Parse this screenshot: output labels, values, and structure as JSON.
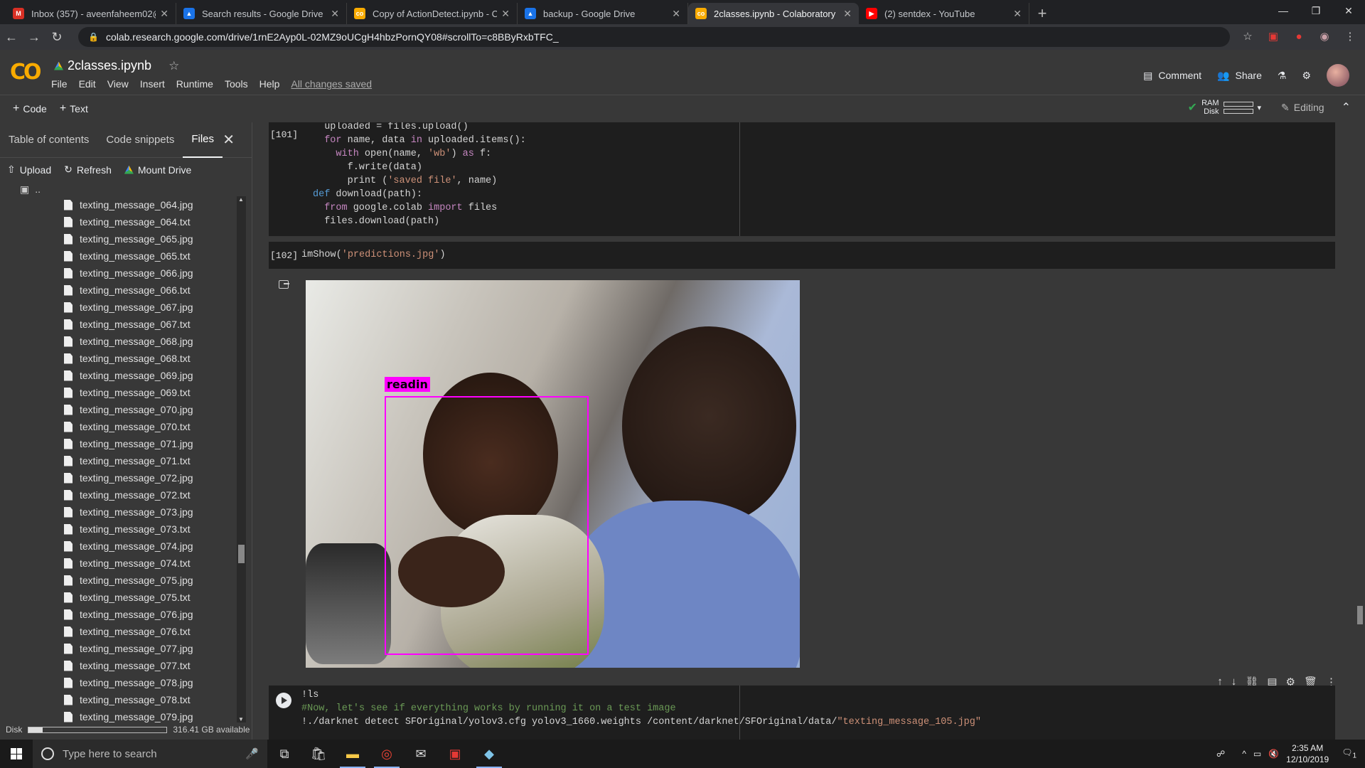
{
  "browser": {
    "tabs": [
      {
        "title": "Inbox (357) - aveenfaheem02@g",
        "icon": "gmail-icon",
        "color": "#d93025",
        "glyph": "M",
        "active": false
      },
      {
        "title": "Search results - Google Drive",
        "icon": "drive-icon",
        "color": "#1a73e8",
        "glyph": "▲",
        "active": false
      },
      {
        "title": "Copy of ActionDetect.ipynb - Col",
        "icon": "colab-icon",
        "color": "#f9ab00",
        "glyph": "co",
        "active": false
      },
      {
        "title": "backup - Google Drive",
        "icon": "drive-icon",
        "color": "#1a73e8",
        "glyph": "▲",
        "active": false
      },
      {
        "title": "2classes.ipynb - Colaboratory",
        "icon": "colab-icon",
        "color": "#f9ab00",
        "glyph": "co",
        "active": true
      },
      {
        "title": "(2) sentdex - YouTube",
        "icon": "youtube-icon",
        "color": "#ff0000",
        "glyph": "▶",
        "active": false
      }
    ],
    "url": "colab.research.google.com/drive/1rnE2Ayp0L-02MZ9oUCgH4hbzPornQY08#scrollTo=c8BByRxbTFC_"
  },
  "header": {
    "logo": "CO",
    "title": "2classes.ipynb",
    "menus": [
      "File",
      "Edit",
      "View",
      "Insert",
      "Runtime",
      "Tools",
      "Help"
    ],
    "saved": "All changes saved",
    "comment": "Comment",
    "share": "Share"
  },
  "toolbar": {
    "code": "Code",
    "text": "Text",
    "ram": "RAM",
    "disk": "Disk",
    "editing": "Editing"
  },
  "sidebar": {
    "tabs": [
      "Table of contents",
      "Code snippets",
      "Files"
    ],
    "actions": {
      "upload": "Upload",
      "refresh": "Refresh",
      "mount": "Mount Drive"
    },
    "parent": "..",
    "files": [
      "texting_message_064.jpg",
      "texting_message_064.txt",
      "texting_message_065.jpg",
      "texting_message_065.txt",
      "texting_message_066.jpg",
      "texting_message_066.txt",
      "texting_message_067.jpg",
      "texting_message_067.txt",
      "texting_message_068.jpg",
      "texting_message_068.txt",
      "texting_message_069.jpg",
      "texting_message_069.txt",
      "texting_message_070.jpg",
      "texting_message_070.txt",
      "texting_message_071.jpg",
      "texting_message_071.txt",
      "texting_message_072.jpg",
      "texting_message_072.txt",
      "texting_message_073.jpg",
      "texting_message_073.txt",
      "texting_message_074.jpg",
      "texting_message_074.txt",
      "texting_message_075.jpg",
      "texting_message_075.txt",
      "texting_message_076.jpg",
      "texting_message_076.txt",
      "texting_message_077.jpg",
      "texting_message_077.txt",
      "texting_message_078.jpg",
      "texting_message_078.txt",
      "texting_message_079.jpg"
    ],
    "disk_label": "Disk",
    "disk_available": "316.41 GB available",
    "disk_used_fraction": 0.1
  },
  "cells": {
    "c101_num": "[101]",
    "c102_num": "[102]",
    "c102_fn": "imShow(",
    "c102_str": "'predictions.jpg'",
    "c102_end": ")",
    "detection_label": "readin",
    "c3_line1": "!ls",
    "c3_line2": "#Now, let's see if everything works by running it on a test image",
    "c3_line3a": "!./darknet detect SFOriginal/yolov3.cfg yolov3_1660.weights /content/darknet/SFOriginal/data/",
    "c3_line3b": "\"texting_message_105.jpg\""
  },
  "taskbar": {
    "search_placeholder": "Type here to search",
    "time": "2:35 AM",
    "date": "12/10/2019",
    "notifications": "1"
  }
}
